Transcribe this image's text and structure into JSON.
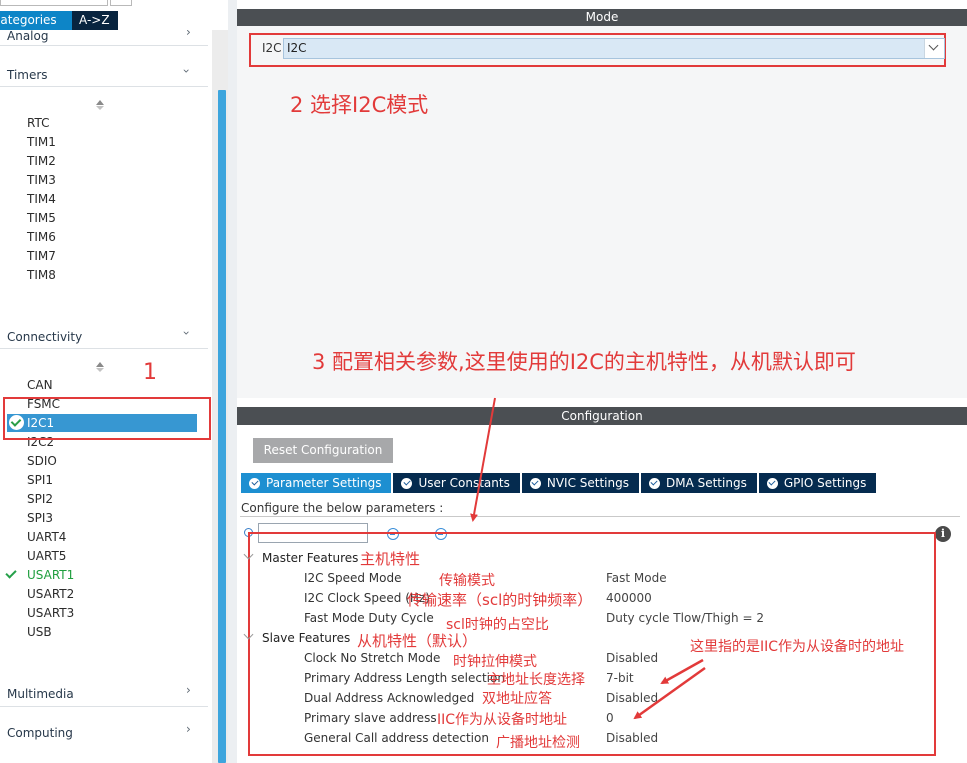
{
  "left_panel": {
    "tabs": [
      "Categories",
      "A->Z"
    ],
    "categories": {
      "analog": "Analog",
      "timers": "Timers",
      "connectivity": "Connectivity",
      "multimedia": "Multimedia",
      "computing": "Computing"
    },
    "timers": [
      "RTC",
      "TIM1",
      "TIM2",
      "TIM3",
      "TIM4",
      "TIM5",
      "TIM6",
      "TIM7",
      "TIM8"
    ],
    "connectivity": [
      "CAN",
      "FSMC",
      "I2C1",
      "I2C2",
      "SDIO",
      "SPI1",
      "SPI2",
      "SPI3",
      "UART4",
      "UART5",
      "USART1",
      "USART2",
      "USART3",
      "USB"
    ],
    "selected": "I2C1",
    "enabled": [
      "I2C1",
      "USART1"
    ],
    "annotation_1": "1"
  },
  "mode": {
    "header": "Mode",
    "i2c_label": "I2C",
    "i2c_value": "I2C",
    "annotation_2": "2 选择I2C模式",
    "annotation_3": "3 配置相关参数,这里使用的I2C的主机特性，从机默认即可"
  },
  "configuration": {
    "header": "Configuration",
    "reset_button": "Reset Configuration",
    "tabs": [
      "Parameter Settings",
      "User Constants",
      "NVIC Settings",
      "DMA Settings",
      "GPIO Settings"
    ],
    "active_tab": "Parameter Settings",
    "configure_text": "Configure the below parameters :",
    "master_group": "Master Features",
    "slave_group": "Slave Features",
    "params": [
      {
        "name": "I2C Speed Mode",
        "value": "Fast Mode"
      },
      {
        "name": "I2C Clock Speed (Hz)",
        "value": "400000"
      },
      {
        "name": "Fast Mode Duty Cycle",
        "value": "Duty cycle Tlow/Thigh = 2"
      },
      {
        "name": "Clock No Stretch Mode",
        "value": "Disabled"
      },
      {
        "name": "Primary Address Length selection",
        "value": "7-bit"
      },
      {
        "name": "Dual Address Acknowledged",
        "value": "Disabled"
      },
      {
        "name": "Primary slave address",
        "value": "0"
      },
      {
        "name": "General Call address detection",
        "value": "Disabled"
      }
    ],
    "notes": {
      "master": "主机特性",
      "slave": "从机特性（默认）",
      "speed_mode": "传输模式",
      "clock_speed": "传输速率（scl的时钟频率）",
      "duty_cycle": "scl时钟的占空比",
      "no_stretch": "时钟拉伸模式",
      "addr_len": "主地址长度选择",
      "dual_addr": "双地址应答",
      "slave_addr": "IIC作为从设备时地址",
      "general_call": "广播地址检测",
      "slave_addr_note": "这里指的是IIC作为从设备时的地址"
    }
  },
  "colors": {
    "annotation_red": "#e23a3a",
    "tab_active": "#1d8fd1",
    "tab_dark": "#052b4f",
    "header_gray": "#4b4f53",
    "selected_row": "#3797d2",
    "enabled_green": "#1f9e3e"
  }
}
